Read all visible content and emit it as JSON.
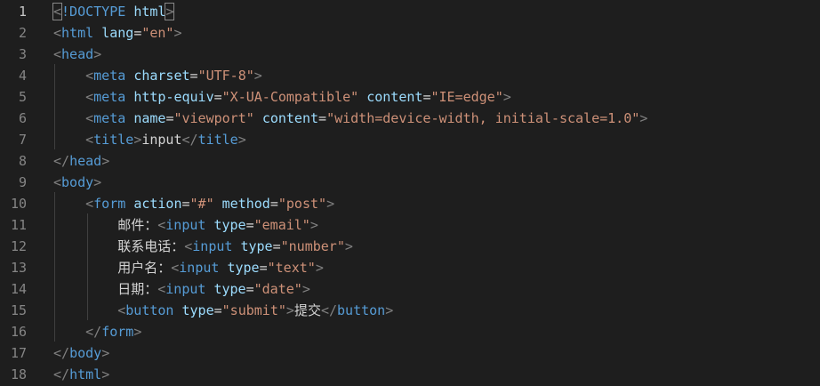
{
  "editor": {
    "line_numbers": [
      "1",
      "2",
      "3",
      "4",
      "5",
      "6",
      "7",
      "8",
      "9",
      "10",
      "11",
      "12",
      "13",
      "14",
      "15",
      "16",
      "17",
      "18"
    ],
    "active_line": "1",
    "lines": [
      [
        {
          "t": "punc",
          "v": "<"
        },
        {
          "t": "doctype-kw",
          "v": "!DOCTYPE"
        },
        {
          "t": "txt",
          "v": " "
        },
        {
          "t": "doctype-name",
          "v": "html"
        },
        {
          "t": "punc",
          "v": ">"
        }
      ],
      [
        {
          "t": "punc",
          "v": "<"
        },
        {
          "t": "tag",
          "v": "html"
        },
        {
          "t": "txt",
          "v": " "
        },
        {
          "t": "attr",
          "v": "lang"
        },
        {
          "t": "txt",
          "v": "="
        },
        {
          "t": "str",
          "v": "\"en\""
        },
        {
          "t": "punc",
          "v": ">"
        }
      ],
      [
        {
          "t": "punc",
          "v": "<"
        },
        {
          "t": "tag",
          "v": "head"
        },
        {
          "t": "punc",
          "v": ">"
        }
      ],
      [
        {
          "t": "txt",
          "v": "    "
        },
        {
          "t": "punc",
          "v": "<"
        },
        {
          "t": "tag",
          "v": "meta"
        },
        {
          "t": "txt",
          "v": " "
        },
        {
          "t": "attr",
          "v": "charset"
        },
        {
          "t": "txt",
          "v": "="
        },
        {
          "t": "str",
          "v": "\"UTF-8\""
        },
        {
          "t": "punc",
          "v": ">"
        }
      ],
      [
        {
          "t": "txt",
          "v": "    "
        },
        {
          "t": "punc",
          "v": "<"
        },
        {
          "t": "tag",
          "v": "meta"
        },
        {
          "t": "txt",
          "v": " "
        },
        {
          "t": "attr",
          "v": "http-equiv"
        },
        {
          "t": "txt",
          "v": "="
        },
        {
          "t": "str",
          "v": "\"X-UA-Compatible\""
        },
        {
          "t": "txt",
          "v": " "
        },
        {
          "t": "attr",
          "v": "content"
        },
        {
          "t": "txt",
          "v": "="
        },
        {
          "t": "str",
          "v": "\"IE=edge\""
        },
        {
          "t": "punc",
          "v": ">"
        }
      ],
      [
        {
          "t": "txt",
          "v": "    "
        },
        {
          "t": "punc",
          "v": "<"
        },
        {
          "t": "tag",
          "v": "meta"
        },
        {
          "t": "txt",
          "v": " "
        },
        {
          "t": "attr",
          "v": "name"
        },
        {
          "t": "txt",
          "v": "="
        },
        {
          "t": "str",
          "v": "\"viewport\""
        },
        {
          "t": "txt",
          "v": " "
        },
        {
          "t": "attr",
          "v": "content"
        },
        {
          "t": "txt",
          "v": "="
        },
        {
          "t": "str",
          "v": "\"width=device-width, initial-scale=1.0\""
        },
        {
          "t": "punc",
          "v": ">"
        }
      ],
      [
        {
          "t": "txt",
          "v": "    "
        },
        {
          "t": "punc",
          "v": "<"
        },
        {
          "t": "tag",
          "v": "title"
        },
        {
          "t": "punc",
          "v": ">"
        },
        {
          "t": "txt",
          "v": "input"
        },
        {
          "t": "punc",
          "v": "</"
        },
        {
          "t": "tag",
          "v": "title"
        },
        {
          "t": "punc",
          "v": ">"
        }
      ],
      [
        {
          "t": "punc",
          "v": "</"
        },
        {
          "t": "tag",
          "v": "head"
        },
        {
          "t": "punc",
          "v": ">"
        }
      ],
      [
        {
          "t": "punc",
          "v": "<"
        },
        {
          "t": "tag",
          "v": "body"
        },
        {
          "t": "punc",
          "v": ">"
        }
      ],
      [
        {
          "t": "txt",
          "v": "    "
        },
        {
          "t": "punc",
          "v": "<"
        },
        {
          "t": "tag",
          "v": "form"
        },
        {
          "t": "txt",
          "v": " "
        },
        {
          "t": "attr",
          "v": "action"
        },
        {
          "t": "txt",
          "v": "="
        },
        {
          "t": "str",
          "v": "\"#\""
        },
        {
          "t": "txt",
          "v": " "
        },
        {
          "t": "attr",
          "v": "method"
        },
        {
          "t": "txt",
          "v": "="
        },
        {
          "t": "str",
          "v": "\"post\""
        },
        {
          "t": "punc",
          "v": ">"
        }
      ],
      [
        {
          "t": "txt",
          "v": "        邮件："
        },
        {
          "t": "punc",
          "v": "<"
        },
        {
          "t": "tag",
          "v": "input"
        },
        {
          "t": "txt",
          "v": " "
        },
        {
          "t": "attr",
          "v": "type"
        },
        {
          "t": "txt",
          "v": "="
        },
        {
          "t": "str",
          "v": "\"email\""
        },
        {
          "t": "punc",
          "v": ">"
        }
      ],
      [
        {
          "t": "txt",
          "v": "        联系电话："
        },
        {
          "t": "punc",
          "v": "<"
        },
        {
          "t": "tag",
          "v": "input"
        },
        {
          "t": "txt",
          "v": " "
        },
        {
          "t": "attr",
          "v": "type"
        },
        {
          "t": "txt",
          "v": "="
        },
        {
          "t": "str",
          "v": "\"number\""
        },
        {
          "t": "punc",
          "v": ">"
        }
      ],
      [
        {
          "t": "txt",
          "v": "        用户名："
        },
        {
          "t": "punc",
          "v": "<"
        },
        {
          "t": "tag",
          "v": "input"
        },
        {
          "t": "txt",
          "v": " "
        },
        {
          "t": "attr",
          "v": "type"
        },
        {
          "t": "txt",
          "v": "="
        },
        {
          "t": "str",
          "v": "\"text\""
        },
        {
          "t": "punc",
          "v": ">"
        }
      ],
      [
        {
          "t": "txt",
          "v": "        日期："
        },
        {
          "t": "punc",
          "v": "<"
        },
        {
          "t": "tag",
          "v": "input"
        },
        {
          "t": "txt",
          "v": " "
        },
        {
          "t": "attr",
          "v": "type"
        },
        {
          "t": "txt",
          "v": "="
        },
        {
          "t": "str",
          "v": "\"date\""
        },
        {
          "t": "punc",
          "v": ">"
        }
      ],
      [
        {
          "t": "txt",
          "v": "        "
        },
        {
          "t": "punc",
          "v": "<"
        },
        {
          "t": "tag",
          "v": "button"
        },
        {
          "t": "txt",
          "v": " "
        },
        {
          "t": "attr",
          "v": "type"
        },
        {
          "t": "txt",
          "v": "="
        },
        {
          "t": "str",
          "v": "\"submit\""
        },
        {
          "t": "punc",
          "v": ">"
        },
        {
          "t": "txt",
          "v": "提交"
        },
        {
          "t": "punc",
          "v": "</"
        },
        {
          "t": "tag",
          "v": "button"
        },
        {
          "t": "punc",
          "v": ">"
        }
      ],
      [
        {
          "t": "txt",
          "v": "    "
        },
        {
          "t": "punc",
          "v": "</"
        },
        {
          "t": "tag",
          "v": "form"
        },
        {
          "t": "punc",
          "v": ">"
        }
      ],
      [
        {
          "t": "punc",
          "v": "</"
        },
        {
          "t": "tag",
          "v": "body"
        },
        {
          "t": "punc",
          "v": ">"
        }
      ],
      [
        {
          "t": "punc",
          "v": "</"
        },
        {
          "t": "tag",
          "v": "html"
        },
        {
          "t": "punc",
          "v": ">"
        }
      ]
    ]
  },
  "colors": {
    "background": "#1e1e1e",
    "tag": "#569cd6",
    "attribute": "#9cdcfe",
    "string": "#ce9178",
    "punctuation": "#808080",
    "text": "#d4d4d4",
    "line_number": "#858585"
  }
}
